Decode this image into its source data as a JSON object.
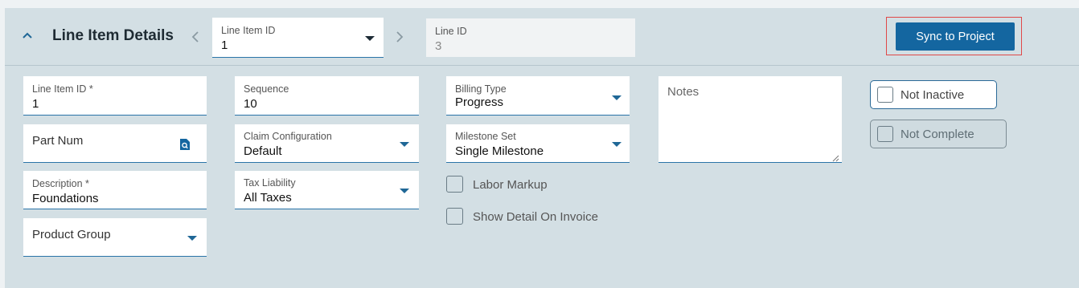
{
  "header": {
    "title": "Line Item Details",
    "nav_prev_icon": "chevron-left-icon",
    "nav_next_icon": "chevron-right-icon",
    "line_item_selector": {
      "label": "Line Item ID",
      "value": "1"
    },
    "line_id": {
      "label": "Line ID",
      "value": "3"
    },
    "sync_button_label": "Sync to Project"
  },
  "form": {
    "line_item_id": {
      "label": "Line Item ID *",
      "value": "1"
    },
    "part_num": {
      "label": "Part Num"
    },
    "description": {
      "label": "Description *",
      "value": "Foundations"
    },
    "product_group": {
      "label": "Product Group"
    },
    "sequence": {
      "label": "Sequence",
      "value": "10"
    },
    "claim_configuration": {
      "label": "Claim Configuration",
      "value": "Default"
    },
    "tax_liability": {
      "label": "Tax Liability",
      "value": "All Taxes"
    },
    "billing_type": {
      "label": "Billing Type",
      "value": "Progress"
    },
    "milestone_set": {
      "label": "Milestone Set",
      "value": "Single Milestone"
    },
    "labor_markup": {
      "label": "Labor Markup",
      "checked": false
    },
    "show_detail_on_invoice": {
      "label": "Show Detail On Invoice",
      "checked": false
    },
    "notes": {
      "label": "Notes",
      "value": ""
    },
    "not_inactive": {
      "label": "Not Inactive",
      "checked": false
    },
    "not_complete": {
      "label": "Not Complete",
      "checked": false
    }
  },
  "colors": {
    "accent": "#1466a0",
    "panel": "#d3dfe4",
    "highlight_outline": "#e04848"
  }
}
